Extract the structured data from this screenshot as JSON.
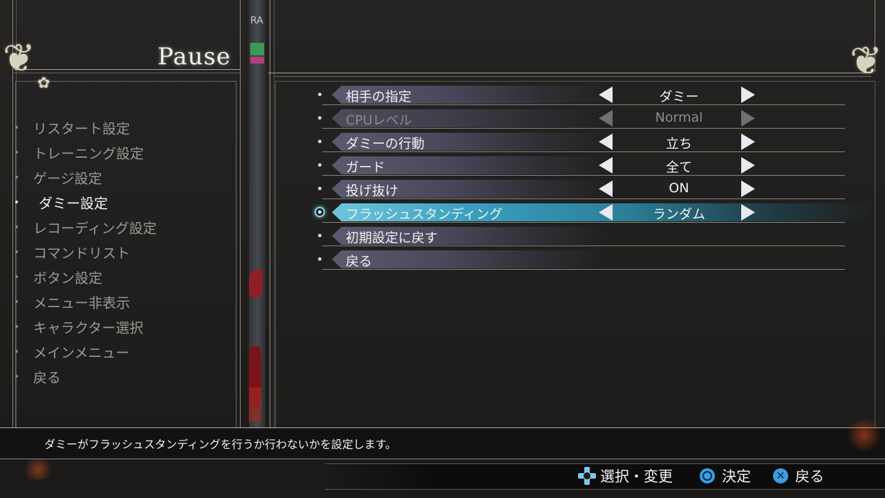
{
  "pause_title": "Pause",
  "left_menu": {
    "items": [
      {
        "label": "リスタート設定",
        "active": false
      },
      {
        "label": "トレーニング設定",
        "active": false
      },
      {
        "label": "ゲージ設定",
        "active": false
      },
      {
        "label": "ダミー設定",
        "active": true
      },
      {
        "label": "レコーディング設定",
        "active": false
      },
      {
        "label": "コマンドリスト",
        "active": false
      },
      {
        "label": "ボタン設定",
        "active": false
      },
      {
        "label": "メニュー非表示",
        "active": false
      },
      {
        "label": "キャラクター選択",
        "active": false
      },
      {
        "label": "メインメニュー",
        "active": false
      },
      {
        "label": "戻る",
        "active": false
      }
    ]
  },
  "strip": {
    "partial_text": "RA"
  },
  "options": {
    "rows": [
      {
        "label": "相手の指定",
        "value": "ダミー",
        "state": "normal"
      },
      {
        "label": "CPUレベル",
        "value": "Normal",
        "state": "disabled"
      },
      {
        "label": "ダミーの行動",
        "value": "立ち",
        "state": "normal"
      },
      {
        "label": "ガード",
        "value": "全て",
        "state": "normal"
      },
      {
        "label": "投げ抜け",
        "value": "ON",
        "state": "normal"
      },
      {
        "label": "フラッシュスタンディング",
        "value": "ランダム",
        "state": "selected"
      },
      {
        "label": "初期設定に戻す",
        "value": "",
        "state": "action"
      },
      {
        "label": "戻る",
        "value": "",
        "state": "action"
      }
    ]
  },
  "description": "ダミーがフラッシュスタンディングを行うか行わないかを設定します。",
  "footer": {
    "select_change": "選択・変更",
    "confirm": "決定",
    "back": "戻る"
  },
  "colors": {
    "selected_accent": "#3aa0c0",
    "button_blue": "#3a9ee0",
    "dpad_blue": "#7fc6ea"
  }
}
